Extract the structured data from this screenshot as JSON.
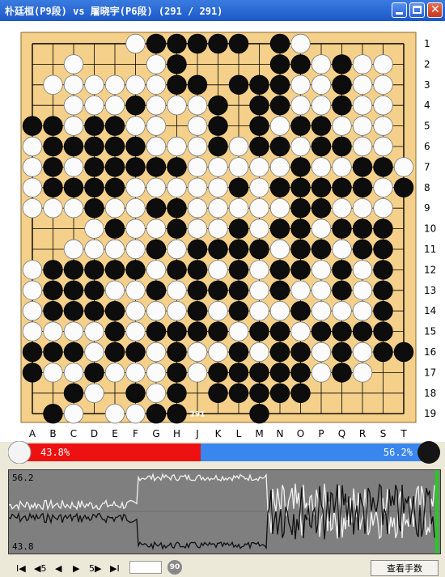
{
  "window": {
    "title": "朴廷桓(P9段) vs 屠晓宇(P6段) (291 / 291)"
  },
  "board": {
    "size": 19,
    "col_labels": [
      "A",
      "B",
      "C",
      "D",
      "E",
      "F",
      "G",
      "H",
      "J",
      "K",
      "L",
      "M",
      "N",
      "O",
      "P",
      "Q",
      "R",
      "S",
      "T"
    ],
    "row_labels": [
      "1",
      "2",
      "3",
      "4",
      "5",
      "6",
      "7",
      "8",
      "9",
      "10",
      "11",
      "12",
      "13",
      "14",
      "15",
      "16",
      "17",
      "18",
      "19"
    ],
    "rows": [
      ".....WBBBBB.BW.....",
      "..W...WB....BBWBWW.",
      ".WWWWWWBB.BBBWWBWW.",
      "..WWWBWWWB.BBWWBWW.",
      "BBWBBWW.WB.BWBBWWW.",
      "WBBBBBWWWBWBBWBBWW.",
      "WBWBBBBBWWWWWBWWBBW",
      "WBBBBWWWWWBWBBBBBWB",
      "WWWBWWBBWWWWWBBWWW.",
      "...WBWWBWWBWBBWBBB.",
      "..WWWWBWBBBBWBBWBB.",
      "WBBBBBWBBWBWBBWBWB.",
      "WBBBWWBWBBBWBWWBWB.",
      "WBBBBWWWBWBWWBWWWB.",
      "WWWWBWBBBBWBBWBBBB.",
      "BBBWBBWBWWBWBBWBWBB",
      "BWWBWWWBWBBBBBWBW..",
      "..BW.BWB.BBBBB.....",
      ".BW.WWBB...B......."
    ],
    "last_move": {
      "col": "J",
      "row": 19,
      "number": "291"
    }
  },
  "score": {
    "left_percent": "43.8%",
    "right_percent": "56.2%",
    "left_color": "#ee1111",
    "right_color": "#3a86ef"
  },
  "graph": {
    "top_label": "56.2",
    "bottom_label": "43.8"
  },
  "toolbar": {
    "first_label": "I◀",
    "back5_label": "◀5",
    "back_label": "◀",
    "fwd_label": "▶",
    "fwd5_label": "5▶",
    "last_label": "▶I",
    "badge_label": "90",
    "view_label": "查看手数"
  }
}
